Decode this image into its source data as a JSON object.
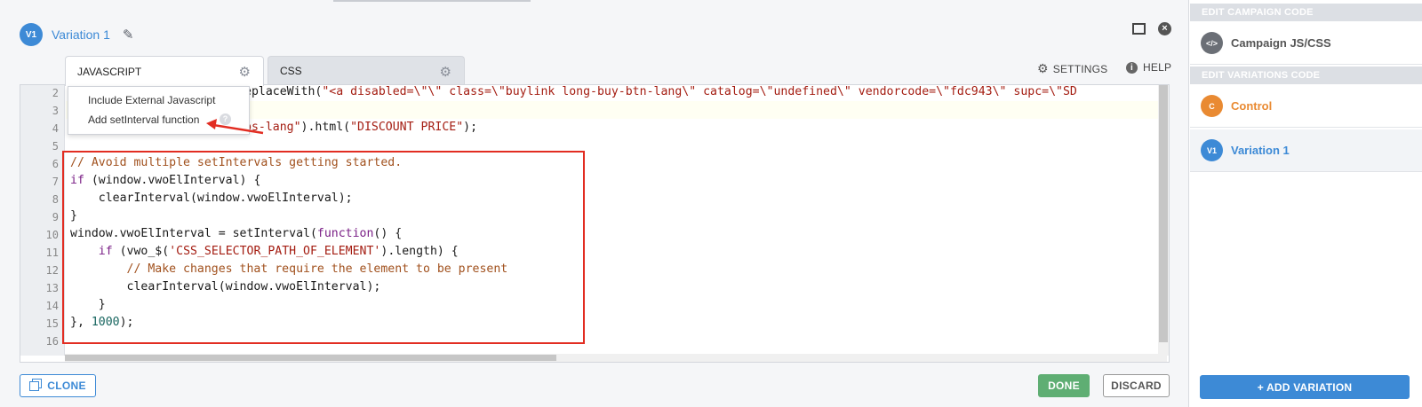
{
  "header": {
    "badge": "V1",
    "title": "Variation 1"
  },
  "tabs": [
    {
      "label": "JAVASCRIPT",
      "active": true
    },
    {
      "label": "CSS",
      "active": false
    }
  ],
  "toolbar": {
    "settings": "SETTINGS",
    "help": "HELP"
  },
  "dropdown": {
    "items": [
      "Include External Javascript",
      "Add setInterval function"
    ],
    "help_icon": "?"
  },
  "editor": {
    "line_numbers": [
      "2",
      "3",
      "4",
      "5",
      "6",
      "7",
      "8",
      "9",
      "10",
      "11",
      "12",
      "13",
      "14",
      "15",
      "16"
    ],
    "line2": [
      "eplaceWith(",
      "\"<a disabled=\\\"\\\" class=\\\"buylink long-buy-btn-lang\\\" catalog=\\\"undefined\\\" vendorcode=\\\"fdc943\\\" supc=\\\"SD"
    ],
    "line4": [
      "ps-lang\"",
      ").html(",
      "\"DISCOUNT PRICE\"",
      ");"
    ],
    "line6": "// Avoid multiple setIntervals getting started.",
    "line7": [
      "if",
      " (window.vwoElInterval) {"
    ],
    "line8": "    clearInterval(window.vwoElInterval);",
    "line9": "}",
    "line10": [
      "window.vwoElInterval = setInterval(",
      "function",
      "() {"
    ],
    "line11": [
      "    ",
      "if",
      " (vwo_$(",
      "'CSS_SELECTOR_PATH_OF_ELEMENT'",
      ").length) {"
    ],
    "line12": "        // Make changes that require the element to be present",
    "line13": "        clearInterval(window.vwoElInterval);",
    "line14": "    }",
    "line15": [
      "}, ",
      "1000",
      ");"
    ]
  },
  "buttons": {
    "clone": "CLONE",
    "done": "DONE",
    "discard": "DISCARD"
  },
  "sidebar": {
    "campaign_header": "EDIT CAMPAIGN CODE",
    "campaign_item": {
      "icon": "</>",
      "label": "Campaign JS/CSS"
    },
    "variations_header": "EDIT VARIATIONS CODE",
    "variations": [
      {
        "badge": "C",
        "label": "Control",
        "color": "#e98a32"
      },
      {
        "badge": "V1",
        "label": "Variation 1",
        "color": "#3d8ad6"
      }
    ],
    "add_variation": "+ ADD VARIATION"
  },
  "colors": {
    "accent": "#3d8ad6",
    "done": "#5fae73",
    "highlight": "#e22d22"
  }
}
